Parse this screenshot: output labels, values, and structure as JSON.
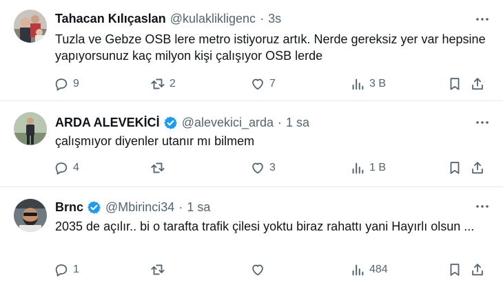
{
  "tweets": [
    {
      "name": "Tahacan Kılıçaslan",
      "verified": false,
      "handle": "@kulaklikligenc",
      "time": "3s",
      "text": "Tuzla ve Gebze OSB lere metro istiyoruz artık. Nerde gereksiz yer var hepsine yapıyorsunuz kaç milyon kişi çalışıyor OSB lerde",
      "replies": "9",
      "retweets": "2",
      "likes": "7",
      "views": "3 B"
    },
    {
      "name": "ARDA ALEVEKİCİ",
      "verified": true,
      "handle": "@alevekici_arda",
      "time": "1 sa",
      "text": "çalışmıyor diyenler utanır mı bilmem",
      "replies": "4",
      "retweets": "",
      "likes": "3",
      "views": "1 B"
    },
    {
      "name": "Brnc",
      "verified": true,
      "handle": "@Mbirinci34",
      "time": "1 sa",
      "text": "2035 de açılır.. bi o tarafta trafik çilesi yoktu biraz rahattı yani Hayırlı olsun ...",
      "replies": "1",
      "retweets": "",
      "likes": "",
      "views": "484"
    }
  ],
  "separator": "·",
  "colors": {
    "text": "#0f1419",
    "secondary": "#536471",
    "verified": "#1d9bf0",
    "divider": "#e7e9ea"
  },
  "icons": [
    "reply-icon",
    "retweet-icon",
    "like-icon",
    "views-icon",
    "bookmark-icon",
    "share-icon",
    "more-icon",
    "verified-badge-icon"
  ]
}
